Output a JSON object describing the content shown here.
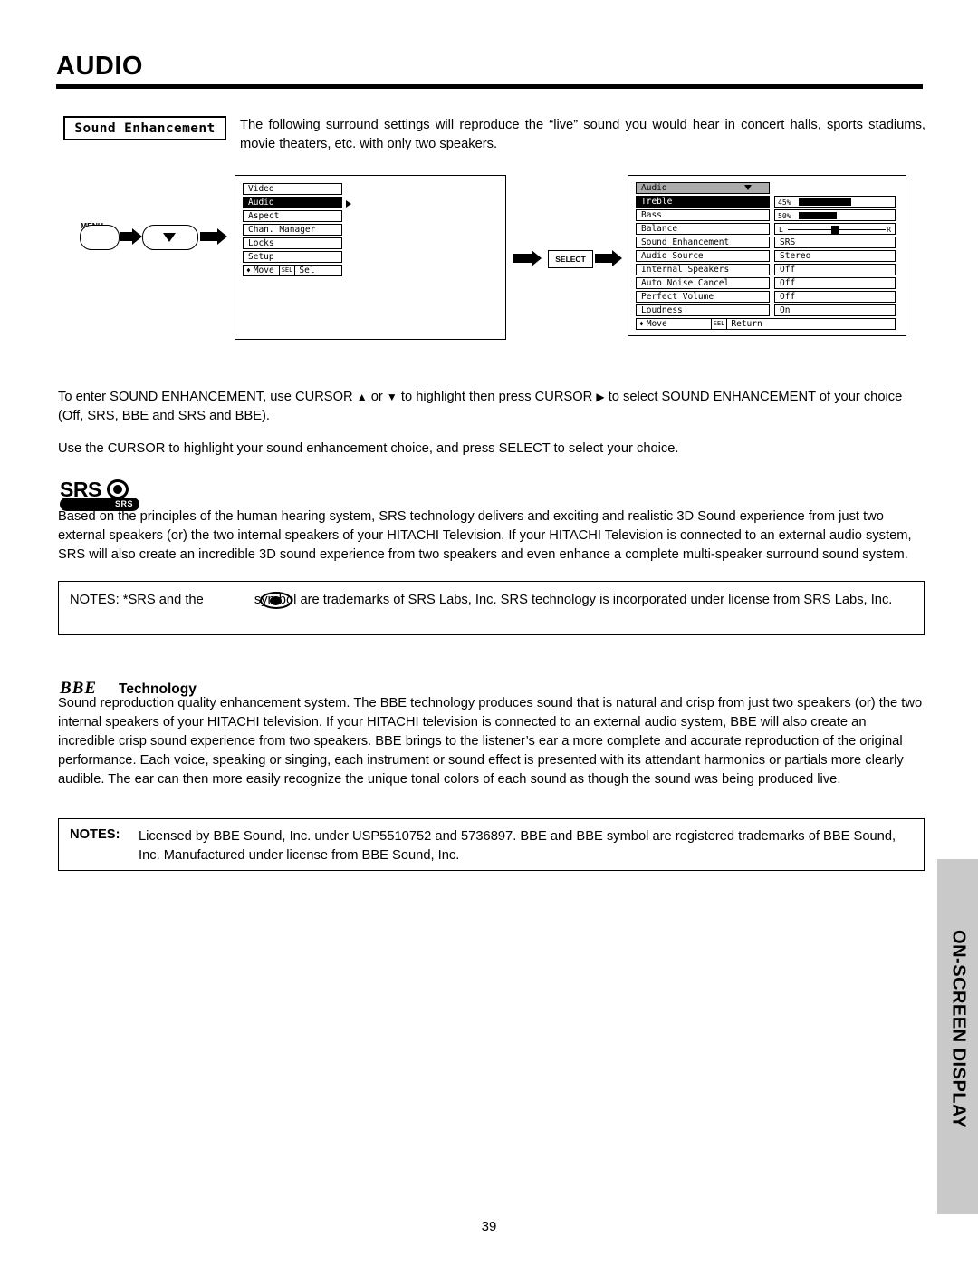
{
  "page": {
    "title": "AUDIO",
    "number": "39",
    "side_tab": "ON-SCREEN DISPLAY"
  },
  "callout": {
    "label": "Sound Enhancement",
    "intro": "The following surround settings will reproduce the “live” sound you would hear in concert halls, sports stadiums, movie theaters, etc. with only two speakers."
  },
  "diagram": {
    "menu_button": "MENU",
    "select_button": "SELECT",
    "left_menu": {
      "items": [
        {
          "label": "Video",
          "state": "normal"
        },
        {
          "label": "Audio",
          "state": "highlight"
        },
        {
          "label": "Aspect",
          "state": "normal"
        },
        {
          "label": "Chan. Manager",
          "state": "normal"
        },
        {
          "label": "Locks",
          "state": "normal"
        },
        {
          "label": "Setup",
          "state": "normal"
        }
      ],
      "footer_move": "Move",
      "footer_key": "SEL",
      "footer_action": "Sel"
    },
    "right_menu": {
      "header": "Audio",
      "rows": [
        {
          "label": "Treble",
          "value": "45%",
          "type": "bar",
          "fill_pct": 45,
          "highlight": true
        },
        {
          "label": "Bass",
          "value": "50%",
          "type": "bar",
          "fill_pct": 50,
          "highlight": false
        },
        {
          "label": "Balance",
          "value": "",
          "type": "balance",
          "left_mark": "L",
          "right_mark": "R",
          "highlight": false
        },
        {
          "label": "Sound Enhancement",
          "value": "SRS",
          "type": "text",
          "highlight": false
        },
        {
          "label": "Audio Source",
          "value": "Stereo",
          "type": "text",
          "highlight": false
        },
        {
          "label": "Internal Speakers",
          "value": "Off",
          "type": "text",
          "highlight": false
        },
        {
          "label": "Auto Noise Cancel",
          "value": "Off",
          "type": "text",
          "highlight": false
        },
        {
          "label": "Perfect Volume",
          "value": "Off",
          "type": "text",
          "highlight": false
        },
        {
          "label": "Loudness",
          "value": "On",
          "type": "text",
          "highlight": false
        }
      ],
      "footer_move": "Move",
      "footer_key": "SEL",
      "footer_action": "Return"
    }
  },
  "body": {
    "enter_paragraph_a": "To enter SOUND ENHANCEMENT, use CURSOR",
    "enter_cursor_up": "▲",
    "enter_paragraph_b": "or",
    "enter_cursor_down": "▼",
    "enter_paragraph_c": "to highlight then press CURSOR",
    "enter_cursor_right": "▶",
    "enter_paragraph_d": "to select SOUND ENHANCEMENT of your choice (Off, SRS, BBE and SRS and BBE).",
    "use_paragraph": "Use the CURSOR to highlight your sound enhancement choice, and press SELECT to select your choice.",
    "srs_logo_word": "SRS",
    "srs_logo_badge": "SRS",
    "srs_paragraph": "Based on the principles of the human hearing system, SRS technology delivers and exciting and realistic 3D Sound experience from just two external speakers (or) the two internal speakers of your HITACHI Television.  If your HITACHI Television is connected to an external audio system, SRS will also create an incredible 3D sound experience from two speakers and even enhance a complete multi-speaker surround sound system.",
    "srs_note_a": "NOTES: *SRS and the",
    "srs_note_b": "symbol are trademarks of SRS Labs, Inc. SRS technology is incorporated under license from SRS Labs, Inc.",
    "bbe_glyph": "BBE",
    "bbe_heading": "Technology",
    "bbe_paragraph": "Sound reproduction quality enhancement system.  The BBE technology produces sound that is natural and crisp from just two speakers (or) the two internal speakers of your HITACHI television. If your HITACHI television is connected to an external audio system, BBE will also create an incredible crisp sound experience from two speakers.  BBE brings to the listener’s ear a more complete and accurate reproduction of the original performance.  Each voice, speaking or singing, each instrument or sound effect is presented with its attendant harmonics or partials more clearly audible.  The ear can then more easily recognize the unique tonal colors of each sound as though the sound was being produced live.",
    "bbe_note_label": "NOTES:",
    "bbe_note_text": "Licensed by BBE Sound, Inc. under USP5510752 and 5736897.  BBE and BBE symbol are registered trademarks of BBE Sound, Inc.  Manufactured under license from BBE Sound, Inc."
  }
}
